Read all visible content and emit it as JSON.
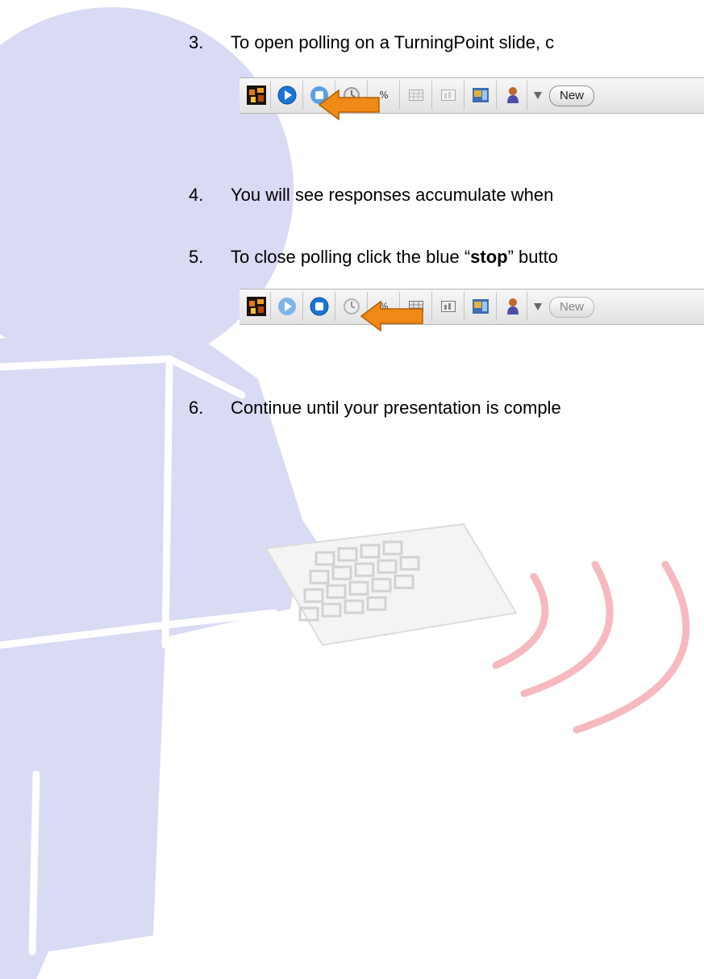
{
  "steps": [
    {
      "number": "3.",
      "text": "To open polling on a TurningPoint slide, c"
    },
    {
      "number": "4.",
      "text": "You will see responses accumulate when"
    },
    {
      "number": "5.",
      "pre": "To close polling click the blue “",
      "bold": "stop",
      "post": "” butto"
    },
    {
      "number": "6.",
      "text": "Continue until your presentation is comple"
    }
  ],
  "toolbar_top": {
    "new_label": "New"
  },
  "toolbar_bottom": {
    "new_label": "New"
  },
  "colors": {
    "figure": "#d9daf3",
    "arrow": "#f08a16",
    "arrow_outline": "#b45c00",
    "waves": "#f6b9bf",
    "start_button": "#1b74d6"
  },
  "icons": [
    "turningpoint-logo-icon",
    "start-polling-icon",
    "stop-polling-icon",
    "timer-icon",
    "percent-icon",
    "grid-icon",
    "chart-icon",
    "slide-icon",
    "participant-icon",
    "dropdown-icon"
  ]
}
